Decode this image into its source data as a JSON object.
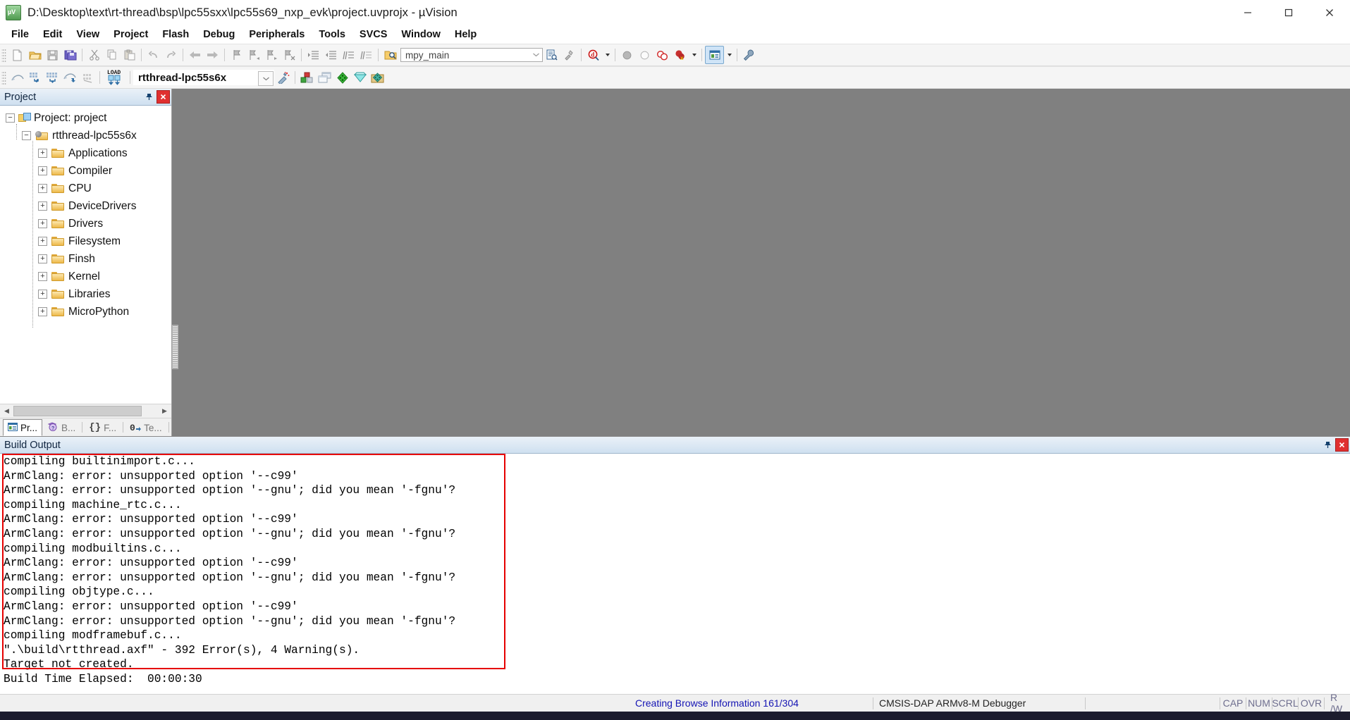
{
  "window": {
    "title": "D:\\Desktop\\text\\rt-thread\\bsp\\lpc55sxx\\lpc55s69_nxp_evk\\project.uvprojx - µVision",
    "app_icon": "uvision-icon",
    "minimize": "─",
    "maximize": "❐",
    "close": "✕"
  },
  "menu": {
    "items": [
      {
        "label": "File"
      },
      {
        "label": "Edit"
      },
      {
        "label": "View"
      },
      {
        "label": "Project"
      },
      {
        "label": "Flash"
      },
      {
        "label": "Debug"
      },
      {
        "label": "Peripherals"
      },
      {
        "label": "Tools"
      },
      {
        "label": "SVCS"
      },
      {
        "label": "Window"
      },
      {
        "label": "Help"
      }
    ]
  },
  "toolbar_main": {
    "buttons": [
      {
        "name": "new-file-icon",
        "tip": "New"
      },
      {
        "name": "open-file-icon",
        "tip": "Open"
      },
      {
        "name": "save-icon",
        "tip": "Save"
      },
      {
        "name": "save-all-icon",
        "tip": "Save All"
      },
      {
        "name": "cut-icon",
        "tip": "Cut"
      },
      {
        "name": "copy-icon",
        "tip": "Copy"
      },
      {
        "name": "paste-icon",
        "tip": "Paste"
      },
      {
        "name": "undo-icon",
        "tip": "Undo"
      },
      {
        "name": "redo-icon",
        "tip": "Redo"
      },
      {
        "name": "navigate-back-icon",
        "tip": "Back"
      },
      {
        "name": "navigate-forward-icon",
        "tip": "Forward"
      },
      {
        "name": "bookmark-toggle-icon",
        "tip": "Insert/Remove Bookmark"
      },
      {
        "name": "bookmark-prev-icon",
        "tip": "Previous Bookmark"
      },
      {
        "name": "bookmark-next-icon",
        "tip": "Next Bookmark"
      },
      {
        "name": "bookmark-clear-icon",
        "tip": "Clear All Bookmarks"
      },
      {
        "name": "indent-icon",
        "tip": "Indent"
      },
      {
        "name": "outdent-icon",
        "tip": "Outdent"
      },
      {
        "name": "comment-icon",
        "tip": "Comment"
      },
      {
        "name": "uncomment-icon",
        "tip": "Uncomment"
      }
    ],
    "find_combo": {
      "value": "mpy_main",
      "placeholder": "Find in Files"
    },
    "find_icon": "find-in-files-icon",
    "after_find": [
      {
        "name": "find-in-files-list-icon",
        "tip": "Find in Files"
      },
      {
        "name": "incremental-find-icon",
        "tip": "Incremental Find"
      }
    ],
    "debug_search": {
      "name": "browse-symbol-icon",
      "tip": "Browse Symbols"
    },
    "breakpoints": [
      {
        "name": "insert-breakpoint-icon"
      },
      {
        "name": "disable-breakpoint-icon"
      },
      {
        "name": "kill-all-breakpoints-icon"
      },
      {
        "name": "disable-all-breakpoints-icon"
      }
    ],
    "window_button": {
      "name": "manage-window-icon",
      "active": true
    },
    "configure_button": {
      "name": "configure-toolbar-icon"
    }
  },
  "toolbar_build": {
    "buttons": [
      {
        "name": "translate-icon",
        "tip": "Translate"
      },
      {
        "name": "build-icon",
        "tip": "Build"
      },
      {
        "name": "rebuild-icon",
        "tip": "Rebuild"
      },
      {
        "name": "batch-build-icon",
        "tip": "Batch Build"
      },
      {
        "name": "stop-build-icon",
        "tip": "Stop Build"
      },
      {
        "name": "download-icon",
        "tip": "Download",
        "label": "LOAD"
      }
    ],
    "target_combo": {
      "value": "rtthread-lpc55s6x"
    },
    "target_options_icon": "target-options-icon",
    "right_buttons": [
      {
        "name": "manage-run-time-environment-icon"
      },
      {
        "name": "multi-project-icon"
      },
      {
        "name": "components-icon"
      },
      {
        "name": "pack-installer-icon"
      },
      {
        "name": "manage-project-items-icon"
      }
    ]
  },
  "project_panel": {
    "title": "Project",
    "pin_icon": "pin-icon",
    "close_icon": "close-icon",
    "tree": [
      {
        "label": "Project: project",
        "icon": "project-icon",
        "indent": 0,
        "expander": "−"
      },
      {
        "label": "rtthread-lpc55s6x",
        "icon": "target-icon",
        "indent": 1,
        "expander": "−"
      },
      {
        "label": "Applications",
        "icon": "folder-icon",
        "indent": 2,
        "expander": "+"
      },
      {
        "label": "Compiler",
        "icon": "folder-icon",
        "indent": 2,
        "expander": "+"
      },
      {
        "label": "CPU",
        "icon": "folder-icon",
        "indent": 2,
        "expander": "+"
      },
      {
        "label": "DeviceDrivers",
        "icon": "folder-icon",
        "indent": 2,
        "expander": "+"
      },
      {
        "label": "Drivers",
        "icon": "folder-icon",
        "indent": 2,
        "expander": "+"
      },
      {
        "label": "Filesystem",
        "icon": "folder-icon",
        "indent": 2,
        "expander": "+"
      },
      {
        "label": "Finsh",
        "icon": "folder-icon",
        "indent": 2,
        "expander": "+"
      },
      {
        "label": "Kernel",
        "icon": "folder-icon",
        "indent": 2,
        "expander": "+"
      },
      {
        "label": "Libraries",
        "icon": "folder-icon",
        "indent": 2,
        "expander": "+"
      },
      {
        "label": "MicroPython",
        "icon": "folder-icon",
        "indent": 2,
        "expander": "+"
      }
    ],
    "tabs": [
      {
        "label": "Pr...",
        "icon": "project-tab-icon",
        "selected": true
      },
      {
        "label": "B...",
        "icon": "books-tab-icon",
        "selected": false
      },
      {
        "label": "F...",
        "icon": "functions-tab-icon",
        "selected": false
      },
      {
        "label": "Te...",
        "icon": "templates-tab-icon",
        "selected": false
      }
    ],
    "scroll_left": "◀",
    "scroll_right": "▶"
  },
  "build_output": {
    "title": "Build Output",
    "pin_icon": "pin-icon",
    "close_icon": "close-icon",
    "lines": [
      "compiling builtinimport.c...",
      "ArmClang: error: unsupported option '--c99'",
      "ArmClang: error: unsupported option '--gnu'; did you mean '-fgnu'?",
      "compiling machine_rtc.c...",
      "ArmClang: error: unsupported option '--c99'",
      "ArmClang: error: unsupported option '--gnu'; did you mean '-fgnu'?",
      "compiling modbuiltins.c...",
      "ArmClang: error: unsupported option '--c99'",
      "ArmClang: error: unsupported option '--gnu'; did you mean '-fgnu'?",
      "compiling objtype.c...",
      "ArmClang: error: unsupported option '--c99'",
      "ArmClang: error: unsupported option '--gnu'; did you mean '-fgnu'?",
      "compiling modframebuf.c...",
      "\".\\build\\rtthread.axf\" - 392 Error(s), 4 Warning(s).",
      "Target not created.",
      "Build Time Elapsed:  00:00:30"
    ],
    "highlight_color": "#e60000"
  },
  "status_bar": {
    "browse_info": "Creating Browse Information 161/304",
    "debugger": "CMSIS-DAP ARMv8-M Debugger",
    "flags": [
      "CAP",
      "NUM",
      "SCRL",
      "OVR",
      "R /W"
    ]
  },
  "colors": {
    "panel_header_top": "#eaf1f8",
    "panel_header_bottom": "#cfe0f0",
    "editor_background": "#808080",
    "toolbar_background": "#f5f5f5",
    "link": "#1414b4",
    "error_box": "#e60000"
  }
}
